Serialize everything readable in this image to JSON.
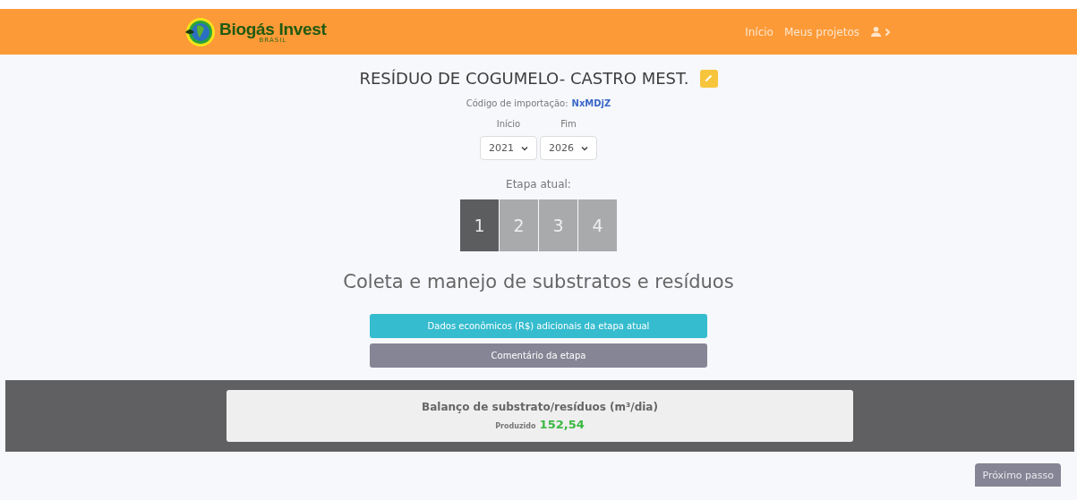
{
  "header": {
    "logo": {
      "name": "Biogás Invest",
      "subtitle": "BRASIL"
    },
    "nav": [
      "Início",
      "Meus projetos"
    ]
  },
  "project": {
    "title": "RESÍDUO DE COGUMELO- CASTRO MEST.",
    "import_label": "Código de importação:",
    "import_code": "NxMDjZ"
  },
  "period": [
    {
      "label": "Início",
      "value": "2021"
    },
    {
      "label": "Fim",
      "value": "2026"
    }
  ],
  "stage_label": "Etapa atual:",
  "stages": [
    {
      "label": "1",
      "selected": true
    },
    {
      "label": "2",
      "selected": false
    },
    {
      "label": "3",
      "selected": false
    },
    {
      "label": "4",
      "selected": false
    }
  ],
  "stage_title": "Coleta e manejo de substratos e resíduos",
  "actions": [
    {
      "label": "Dados econômicos (R$) adicionais da etapa atual",
      "kind": "info"
    },
    {
      "label": "Comentário da etapa",
      "kind": "secondary"
    }
  ],
  "balance": {
    "title": "Balanço de substrato/resíduos (m³/dia)",
    "label": "Produzido",
    "value": "152,54"
  },
  "next_button": "Próximo passo"
}
